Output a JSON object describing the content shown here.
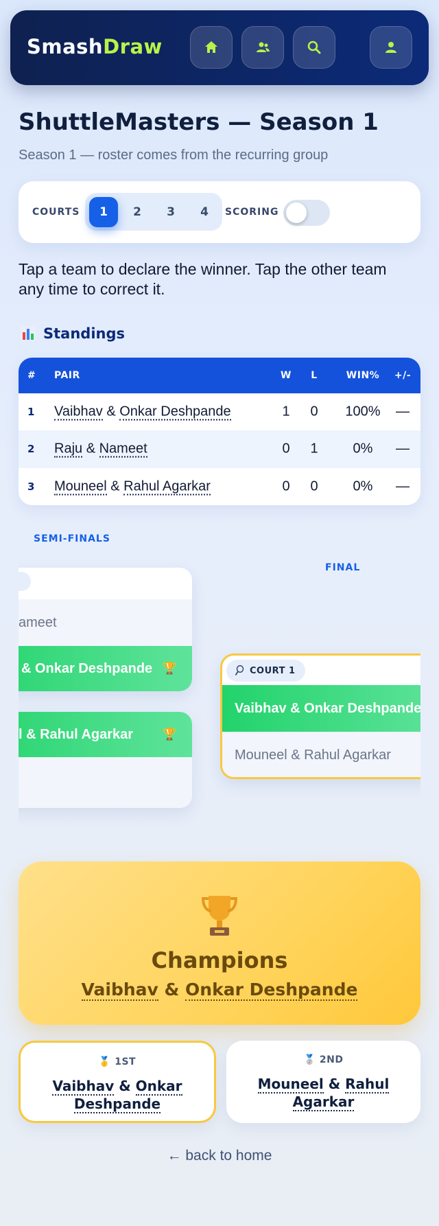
{
  "header": {
    "logo_part1": "Smash",
    "logo_part2": "Draw",
    "nav_icons": [
      "home-icon",
      "groups-icon",
      "search-icon",
      "profile-icon"
    ],
    "accent": "#b9f24a"
  },
  "page": {
    "title": "ShuttleMasters — Season 1",
    "subtitle": "Season 1 — roster comes from the recurring group",
    "instructions": "Tap a team to declare the winner. Tap the other team any time to correct it."
  },
  "controls": {
    "courts_label": "COURTS",
    "courts": [
      "1",
      "2",
      "3",
      "4"
    ],
    "selected_court": "1",
    "scoring_label": "SCORING",
    "scoring_on": false
  },
  "standings": {
    "heading": "Standings",
    "columns": [
      "#",
      "PAIR",
      "W",
      "L",
      "WIN%",
      "+/-"
    ],
    "rows": [
      {
        "rank": "1",
        "p1": "Vaibhav",
        "p2": "Onkar Deshpande",
        "w": "1",
        "l": "0",
        "pct": "100%",
        "diff": "—"
      },
      {
        "rank": "2",
        "p1": "Raju",
        "p2": "Nameet",
        "w": "0",
        "l": "1",
        "pct": "0%",
        "diff": "—"
      },
      {
        "rank": "3",
        "p1": "Mouneel",
        "p2": "Rahul Agarkar",
        "w": "0",
        "l": "0",
        "pct": "0%",
        "diff": "—"
      }
    ]
  },
  "bracket": {
    "semi_label": "SEMI-FINALS",
    "final_label": "FINAL",
    "semi1": {
      "top": "ameet",
      "bottom": "& Onkar Deshpande"
    },
    "semi2": {
      "top": "l & Rahul Agarkar"
    },
    "final": {
      "court": "COURT 1",
      "winner": "Vaibhav & Onkar Deshpande",
      "loser": "Mouneel & Rahul Agarkar"
    }
  },
  "champions": {
    "title": "Champions",
    "p1": "Vaibhav",
    "p2": "Onkar Deshpande"
  },
  "podium": {
    "first_label": "1ST",
    "first_p1": "Vaibhav",
    "first_p2": "Onkar Deshpande",
    "second_label": "2ND",
    "second_p1": "Mouneel",
    "second_p2": "Rahul Agarkar"
  },
  "footer": {
    "back_link": "← back to home"
  }
}
